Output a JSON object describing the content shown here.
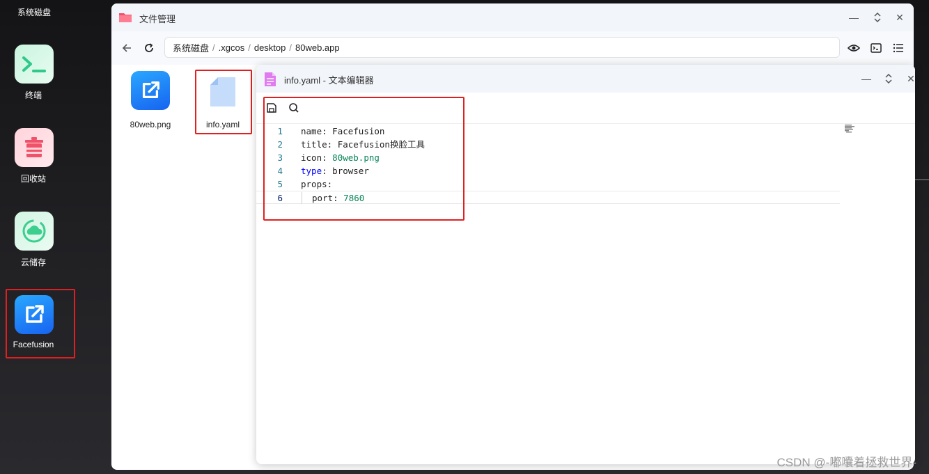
{
  "desktop": {
    "label": "系统磁盘",
    "items": [
      {
        "label": "终端",
        "icon": "terminal-icon"
      },
      {
        "label": "回收站",
        "icon": "trash-icon"
      },
      {
        "label": "云储存",
        "icon": "cloud-sync-icon"
      },
      {
        "label": "Facefusion",
        "icon": "external-link-icon"
      }
    ]
  },
  "file_manager": {
    "title": "文件管理",
    "breadcrumb": [
      "系统磁盘",
      ".xgcos",
      "desktop",
      "80web.app"
    ],
    "files": [
      {
        "name": "80web.png",
        "icon": "external-link-icon"
      },
      {
        "name": "info.yaml",
        "icon": "file-icon"
      }
    ]
  },
  "editor": {
    "title": "info.yaml - 文本编辑器",
    "lines": [
      {
        "num": "1",
        "key": "name",
        "value": "Facefusion"
      },
      {
        "num": "2",
        "key": "title",
        "value": "Facefusion换脸工具"
      },
      {
        "num": "3",
        "key": "icon",
        "value": "80web.png"
      },
      {
        "num": "4",
        "key": "type",
        "value": "browser"
      },
      {
        "num": "5",
        "key": "props",
        "value": ""
      },
      {
        "num": "6",
        "key": "port",
        "value": "7860"
      }
    ]
  },
  "watermark": "CSDN @-嘟囔着拯救世界-",
  "colors": {
    "terminal": "#2fc98a",
    "trash": "#f0526a",
    "cloud": "#3ccf8e",
    "app_blue": "#1e7cf2",
    "highlight": "#e02020"
  }
}
